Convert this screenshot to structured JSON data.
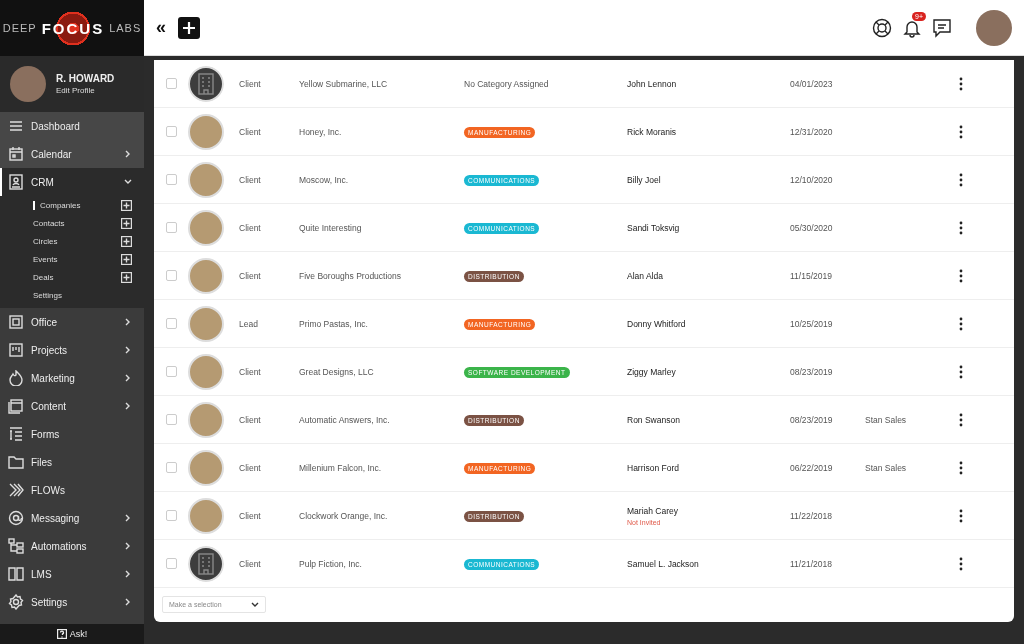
{
  "brand": {
    "left": "DEEP",
    "middle": "FOCUS",
    "right": "LABS"
  },
  "profile": {
    "name": "R. HOWARD",
    "link": "Edit Profile"
  },
  "sidebar": {
    "items": [
      {
        "label": "Dashboard",
        "has_arrow": false,
        "selected": false
      },
      {
        "label": "Calendar",
        "has_arrow": true,
        "selected": false
      },
      {
        "label": "CRM",
        "has_arrow": true,
        "selected": true,
        "expanded": true,
        "children": [
          {
            "label": "Companies",
            "selected": true,
            "has_add": true
          },
          {
            "label": "Contacts",
            "selected": false,
            "has_add": true
          },
          {
            "label": "Circles",
            "selected": false,
            "has_add": true
          },
          {
            "label": "Events",
            "selected": false,
            "has_add": true
          },
          {
            "label": "Deals",
            "selected": false,
            "has_add": true
          },
          {
            "label": "Settings",
            "selected": false,
            "has_add": false
          }
        ]
      },
      {
        "label": "Office",
        "has_arrow": true,
        "selected": false
      },
      {
        "label": "Projects",
        "has_arrow": true,
        "selected": false
      },
      {
        "label": "Marketing",
        "has_arrow": true,
        "selected": false
      },
      {
        "label": "Content",
        "has_arrow": true,
        "selected": false
      },
      {
        "label": "Forms",
        "has_arrow": false,
        "selected": false
      },
      {
        "label": "Files",
        "has_arrow": false,
        "selected": false
      },
      {
        "label": "FLOWs",
        "has_arrow": false,
        "selected": false
      },
      {
        "label": "Messaging",
        "has_arrow": true,
        "selected": false
      },
      {
        "label": "Automations",
        "has_arrow": true,
        "selected": false
      },
      {
        "label": "LMS",
        "has_arrow": true,
        "selected": false
      },
      {
        "label": "Settings",
        "has_arrow": true,
        "selected": false
      }
    ],
    "ask": "Ask!"
  },
  "topbar": {
    "collapse": "«",
    "notifications_badge": "9+"
  },
  "table": {
    "rows": [
      {
        "checked": false,
        "avatar": {
          "kind": "building"
        },
        "type": "Client",
        "company": "Yellow Submarine, LLC",
        "category": {
          "kind": "none",
          "label": "No Category Assigned"
        },
        "contact": "John Lennon",
        "date": "04/01/2023"
      },
      {
        "checked": false,
        "avatar": {
          "kind": "photo"
        },
        "type": "Client",
        "company": "Honey, Inc.",
        "category": {
          "kind": "tag",
          "label": "MANUFACTURING",
          "color": "#f26522"
        },
        "contact": "Rick Moranis",
        "date": "12/31/2020"
      },
      {
        "checked": false,
        "avatar": {
          "kind": "photo"
        },
        "type": "Client",
        "company": "Moscow, Inc.",
        "category": {
          "kind": "tag",
          "label": "COMMUNICATIONS",
          "color": "#1ab8d2"
        },
        "contact": "Billy Joel",
        "date": "12/10/2020"
      },
      {
        "checked": false,
        "avatar": {
          "kind": "photo"
        },
        "type": "Client",
        "company": "Quite Interesting",
        "category": {
          "kind": "tag",
          "label": "COMMUNICATIONS",
          "color": "#1ab8d2"
        },
        "contact": "Sandi Toksvig",
        "date": "05/30/2020"
      },
      {
        "checked": false,
        "avatar": {
          "kind": "photo"
        },
        "type": "Client",
        "company": "Five Boroughs Productions",
        "category": {
          "kind": "tag",
          "label": "DISTRIBUTION",
          "color": "#7b5244"
        },
        "contact": "Alan Alda",
        "date": "11/15/2019"
      },
      {
        "checked": false,
        "avatar": {
          "kind": "photo"
        },
        "type": "Lead",
        "company": "Primo Pastas, Inc.",
        "category": {
          "kind": "tag",
          "label": "MANUFACTURING",
          "color": "#f26522"
        },
        "contact": "Donny Whitford",
        "date": "10/25/2019"
      },
      {
        "checked": false,
        "avatar": {
          "kind": "photo"
        },
        "type": "Client",
        "company": "Great Designs, LLC",
        "category": {
          "kind": "tag",
          "label": "SOFTWARE DEVELOPMENT",
          "color": "#3bb44a"
        },
        "contact": "Ziggy Marley",
        "date": "08/23/2019"
      },
      {
        "checked": false,
        "avatar": {
          "kind": "photo"
        },
        "type": "Client",
        "company": "Automatic Answers, Inc.",
        "category": {
          "kind": "tag",
          "label": "DISTRIBUTION",
          "color": "#7b5244"
        },
        "contact": "Ron Swanson",
        "date": "08/23/2019",
        "owner": "Stan Sales"
      },
      {
        "checked": false,
        "avatar": {
          "kind": "photo"
        },
        "type": "Client",
        "company": "Millenium Falcon, Inc.",
        "category": {
          "kind": "tag",
          "label": "MANUFACTURING",
          "color": "#f26522"
        },
        "contact": "Harrison Ford",
        "date": "06/22/2019",
        "owner": "Stan Sales"
      },
      {
        "checked": false,
        "avatar": {
          "kind": "photo"
        },
        "type": "Client",
        "company": "Clockwork Orange, Inc.",
        "category": {
          "kind": "tag",
          "label": "DISTRIBUTION",
          "color": "#7b5244"
        },
        "contact": "Mariah Carey",
        "contact_note": "Not Invited",
        "date": "11/22/2018"
      },
      {
        "checked": false,
        "avatar": {
          "kind": "building"
        },
        "type": "Client",
        "company": "Pulp Fiction, Inc.",
        "category": {
          "kind": "tag",
          "label": "COMMUNICATIONS",
          "color": "#1ab8d2"
        },
        "contact": "Samuel L. Jackson",
        "date": "11/21/2018"
      }
    ],
    "bulk_select": {
      "placeholder": "Make a selection"
    }
  }
}
